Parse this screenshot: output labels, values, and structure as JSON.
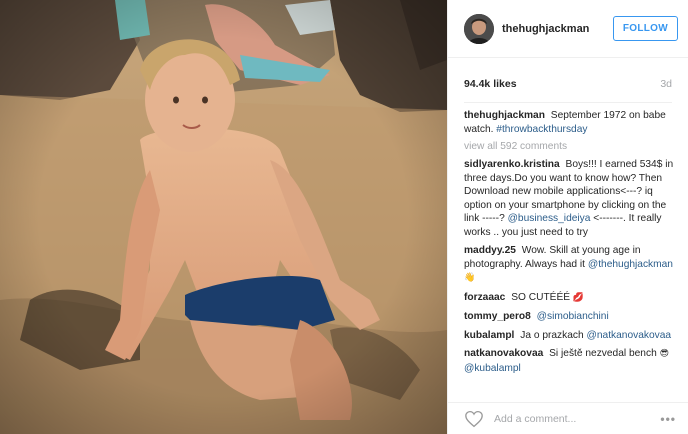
{
  "header": {
    "username": "thehughjackman",
    "follow_label": "FOLLOW"
  },
  "meta": {
    "likes": "94.4k likes",
    "time": "3d"
  },
  "caption": {
    "user": "thehughjackman",
    "text": "September 1972 on babe watch.",
    "hashtag": "#throwbackthursday"
  },
  "view_all": "view all 592 comments",
  "comments": [
    {
      "user": "sidlyarenko.kristina",
      "text": "Boys!!! I earned 534$ in three days.Do you want to know how? Then Download new mobile applications<---? iq option on your smartphone by clicking on the link -----?",
      "mention": "@business_ideiya",
      "text2": "<-------. It really works .. you just need to try"
    },
    {
      "user": "maddyy.25",
      "text": "Wow. Skill at young age in photography. Always had it",
      "mention": "@thehughjackman",
      "emoji": "👋"
    },
    {
      "user": "forzaaac",
      "text": "SO CUTÉÉÉ",
      "emoji": "💋"
    },
    {
      "user": "tommy_pero8",
      "mention": "@simobianchini"
    },
    {
      "user": "kubalampl",
      "text": "Ja o prazkach",
      "mention": "@natkanovakovaa"
    },
    {
      "user": "natkanovakovaa",
      "text": "Si ještě nezvedal bench",
      "emoji": "😎",
      "mention": "@kubalampl"
    }
  ],
  "footer": {
    "add_comment_placeholder": "Add a comment...",
    "more": "•••"
  },
  "icons": {
    "like": "heart-icon",
    "more": "more-options-icon"
  },
  "colors": {
    "follow": "#3897f0",
    "link": "#2c5d8a",
    "muted": "#a5a7aa"
  }
}
